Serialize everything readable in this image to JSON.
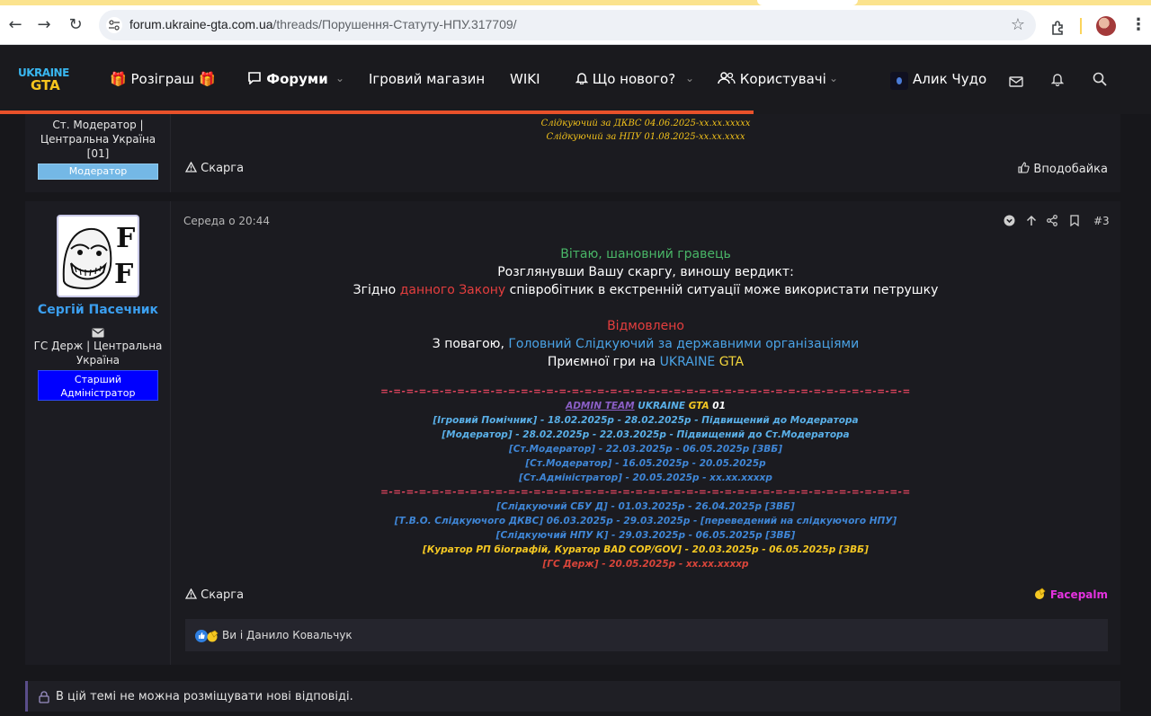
{
  "browser": {
    "url_domain": "forum.ukraine-gta.com.ua",
    "url_path": "/threads/Порушення-Статуту-НПУ.317709/"
  },
  "site": {
    "logo_top": "UKRAINE",
    "logo_bottom": "GTA",
    "nav": {
      "giveaway": "Розіграш",
      "forums": "Форуми",
      "shop": "Ігровий магазин",
      "wiki": "WIKI",
      "whats_new": "Що нового?",
      "users": "Користувачі"
    },
    "username": "Алик Чудо"
  },
  "post_prev": {
    "user_title_line1": "Ст. Модератор |",
    "user_title_line2": "Центральна Україна",
    "user_title_line3": "[01]",
    "badge": "Модератор",
    "sig_line1": "Слідкуючий за ДКВС 04.06.2025-xx.xx.xxxxx",
    "sig_line2": "Слідкуючий за НПУ 01.08.2025-xx.xx.xxxx",
    "report": "Скарга",
    "like": "Вподобайка"
  },
  "post": {
    "username": "Сергій Пасечник",
    "user_title_line1": "ГС Держ | Центральна",
    "user_title_line2": "Україна",
    "badge_line1": "Старший",
    "badge_line2": "Адміністратор",
    "date": "Середа о 20:44",
    "number": "#3",
    "message": {
      "greeting": "Вітаю, шановний гравець",
      "line2": "Розглянувши Вашу скаргу, виношу вердикт:",
      "line3_pre": "Згідно ",
      "line3_link": "данного Закону",
      "line3_post": " співробітник в екстренній ситуації може використати петрушку",
      "verdict": "Відмовлено",
      "regards_pre": "З повагою, ",
      "regards_role": "Головний Слідкуючий за державними організаціями",
      "enjoy_pre": "Приємної гри на ",
      "enjoy_ukraine": "UKRAINE",
      "enjoy_gta": "GTA"
    },
    "signature": {
      "separator": "=-=-=-=-=-=-=-=-=-=-=-=-=-=-=-=-=-=-=-=-=-=-=-=-=-=-=-=-=-=-=-=-=-=-=-=-=-=-=-=-=-=",
      "admin_team": "ADMIN TEAM",
      "admin_ukraine": " UKRAINE ",
      "admin_gta": "GTA",
      "admin_num": " 01",
      "l1": "[Ігровий Помічник] - 18.02.2025р - 28.02.2025р - Підвищений до Модератора",
      "l2": "[Модератор] - 28.02.2025р - 22.03.2025р - Підвищений до Ст.Модератора",
      "l3": "[Ст.Модератор] - 22.03.2025р - 06.05.2025р [ЗВБ]",
      "l4": "[Ст.Модератор] - 16.05.2025р - 20.05.2025р",
      "l5": "[Ст.Адміністратор] - 20.05.2025р - xx.xx.xxxxр",
      "separator2": "=-=-=-=-=-=-=-=-=-=-=-=-=-=-=-=-=-=-=-=-=-=-=-=-=-=-=-=-=-=-=-=-=-=-=-=-=-=-=-=-=-=",
      "l6": "[Слідкуючий СБУ Д] - 01.03.2025р - 26.04.2025р [ЗВБ]",
      "l7": "[Т.В.О. Слідкуючого ДКВС] 06.03.2025р - 29.03.2025р - [переведений на слідкуючого НПУ]",
      "l8": "[Слідкуючий НПУ К] - 29.03.2025р - 06.05.2025р [ЗВБ]",
      "l9": "[Куратор РП біографій, Куратор BAD COP/GOV] - 20.03.2025р - 06.05.2025р [ЗВБ]",
      "l10": "[ГС Держ] - 20.05.2025р - xx.xx.xxxxр"
    },
    "report": "Скарга",
    "reaction_label": "Facepalm",
    "reactions_text": "Ви і Данило Ковальчук"
  },
  "thread_notice": "В цій темі не можна розміщувати нові відповіді.",
  "colors": {
    "accent_progress": "#e8512a",
    "username_blue": "#3b9ff0",
    "admin_badge": "#0000ff",
    "mod_badge": "#74b8e6"
  },
  "icons": [
    "back-arrow-icon",
    "forward-arrow-icon",
    "reload-icon",
    "site-settings-icon",
    "star-icon",
    "extensions-icon",
    "profile-icon",
    "gift-icon",
    "chat-icon",
    "bell-icon",
    "users-icon",
    "mail-icon",
    "search-icon",
    "warning-icon",
    "thumbs-up-icon",
    "lock-icon",
    "chevron-down-icon"
  ]
}
